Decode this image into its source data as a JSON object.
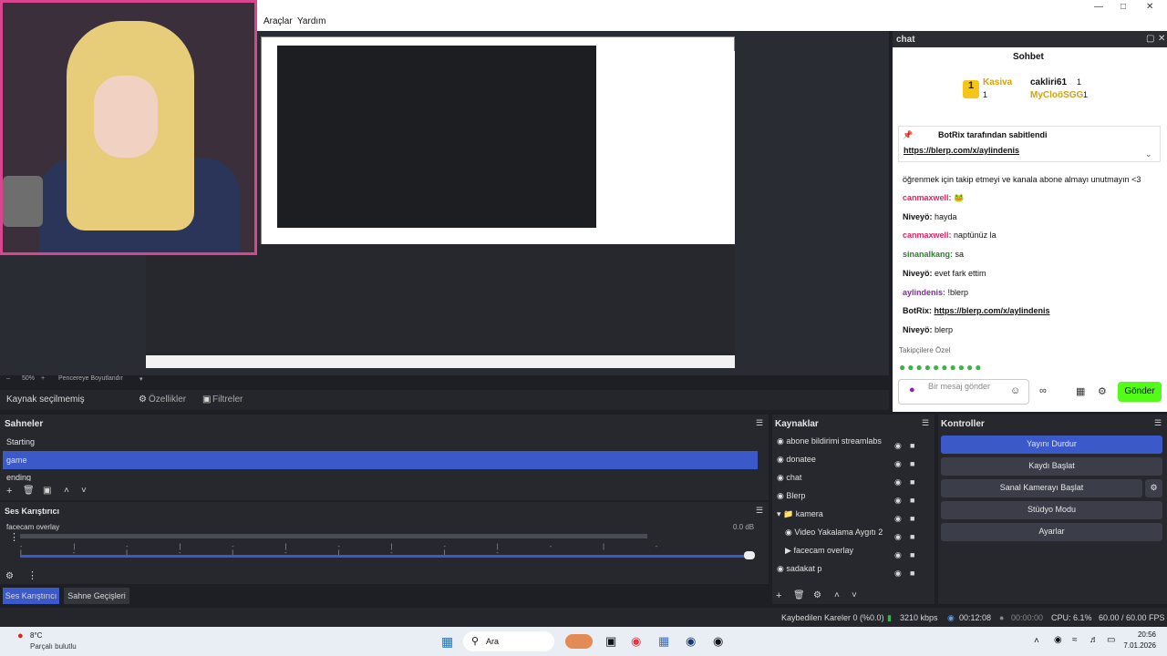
{
  "menubar": {
    "items": [
      "Araçlar",
      "Yardım"
    ]
  },
  "preview": {
    "zoom": "50%",
    "fit_label": "Pencereye Boyutlandır"
  },
  "chat": {
    "panel_title": "chat",
    "header": "Sohbet",
    "top_gifters": [
      {
        "rank": "1",
        "name": "Kasiva",
        "count": "1"
      },
      {
        "name": "cakliri61",
        "count": "1"
      },
      {
        "name": "MyCloöSGG",
        "count": "1"
      }
    ],
    "pinned_by": "BotRix tarafından sabitlendi",
    "pinned_link": "https://blerp.com/x/aylindenis",
    "messages": [
      {
        "user": "",
        "text": "öğrenmek için takip etmeyi ve kanala abone almayı unutmayın <3"
      },
      {
        "user": "canmaxwell:",
        "text": ""
      },
      {
        "user": "Niveyö:",
        "text": "hayda"
      },
      {
        "user": "canmaxwell:",
        "text": "naptünüz la"
      },
      {
        "user": "sinanalkang:",
        "text": "sa"
      },
      {
        "user": "Niveyö:",
        "text": "evet fark ettim"
      },
      {
        "user": "aylindenis:",
        "text": "!blerp"
      },
      {
        "user": "BotRix:",
        "text": "https://blerp.com/x/aylindenis"
      },
      {
        "user": "Niveyö:",
        "text": "blerp"
      }
    ],
    "followers_label": "Takipçilere Özel",
    "input_placeholder": "Bir mesaj gönder",
    "send_label": "Gönder"
  },
  "props": {
    "no_source": "Kaynak seçilmemiş",
    "properties": "Özellikler",
    "filters": "Filtreler"
  },
  "scenes": {
    "title": "Sahneler",
    "items": [
      "Starting",
      "game",
      "ending"
    ],
    "active": 1
  },
  "mixer": {
    "title": "Ses Karıştırıcı",
    "channel": "facecam overlay",
    "db": "0.0 dB"
  },
  "tabs": {
    "mixer": "Ses Karıştırıcı",
    "transitions": "Sahne Geçişleri"
  },
  "sources": {
    "title": "Kaynaklar",
    "items": [
      "abone bildirimi streamlabs",
      "donatee",
      "chat",
      "Blerp",
      "kamera",
      "Video Yakalama Aygıtı 2",
      "facecam overlay",
      "sadakat p"
    ]
  },
  "controls": {
    "title": "Kontroller",
    "buttons": [
      "Yayını Durdur",
      "Kaydı Başlat",
      "Sanal Kamerayı Başlat",
      "Stüdyo Modu",
      "Ayarlar"
    ]
  },
  "statusbar": {
    "dropped": "Kaybedilen Kareler 0 (%0.0)",
    "bitrate": "3210 kbps",
    "live_time": "00:12:08",
    "rec_time": "00:00:00",
    "cpu": "CPU: 6.1%",
    "fps": "60.00 / 60.00 FPS"
  },
  "taskbar": {
    "weather_temp": "8°C",
    "weather_desc": "Parçalı bulutlu",
    "search": "Ara",
    "time": "20:56",
    "date": "7.01.2026"
  },
  "colors": {
    "accent": "#3b59c9",
    "kick_green": "#53fc18",
    "webcam_border": "#d9468f"
  }
}
